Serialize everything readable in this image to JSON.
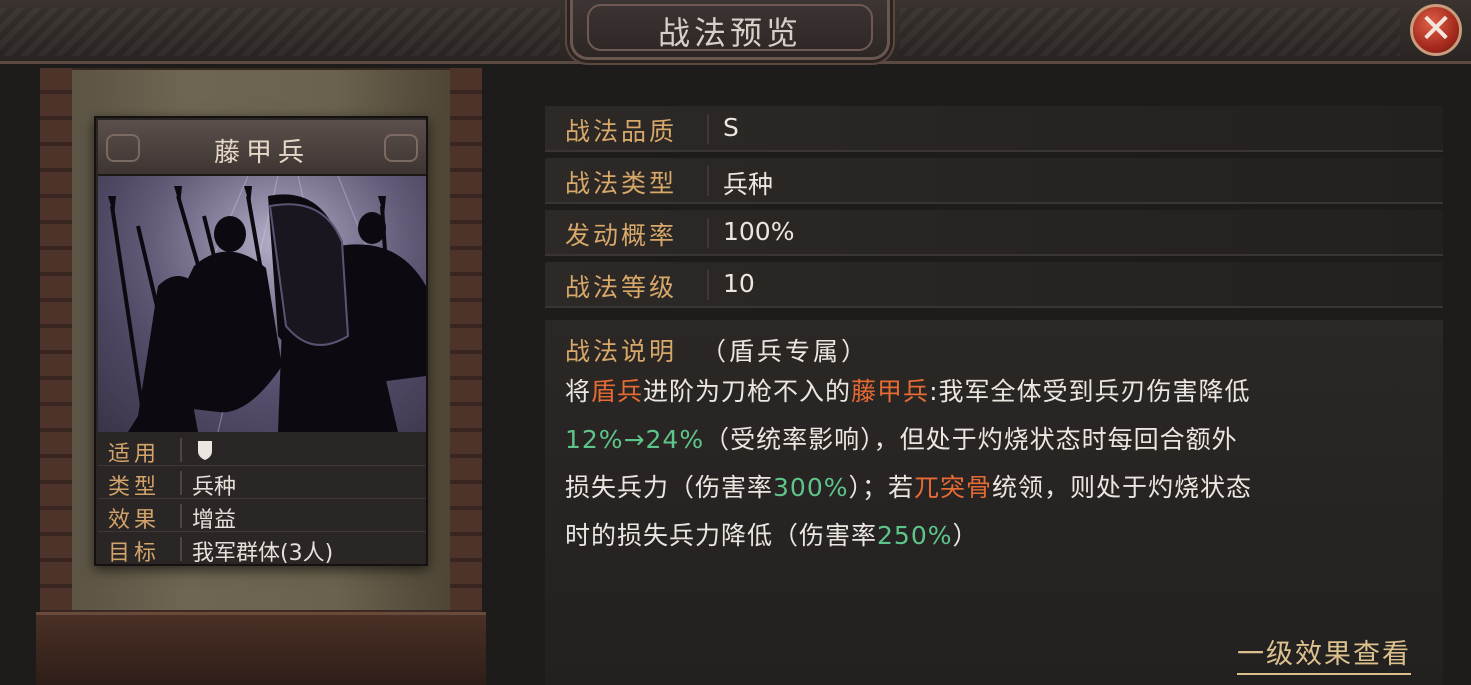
{
  "window": {
    "title": "战法预览",
    "close_label": "✕"
  },
  "card": {
    "name": "藤甲兵",
    "stats": [
      {
        "key": "适用",
        "value": "",
        "icon": "shield-icon"
      },
      {
        "key": "类型",
        "value": "兵种"
      },
      {
        "key": "效果",
        "value": "增益"
      },
      {
        "key": "目标",
        "value": "我军群体(3人)"
      }
    ]
  },
  "info": {
    "rows": [
      {
        "key": "战法品质",
        "value": "S"
      },
      {
        "key": "战法类型",
        "value": "兵种"
      },
      {
        "key": "发动概率",
        "value": "100%"
      },
      {
        "key": "战法等级",
        "value": "10"
      }
    ]
  },
  "description": {
    "key": "战法说明",
    "note": "（盾兵专属）",
    "line1": {
      "a": "将",
      "b": "盾兵",
      "c": "进阶为刀枪不入的",
      "d": "藤甲兵",
      "e": ":我军全体受到兵刃伤害降低"
    },
    "line2": {
      "a": "12%→24%",
      "b": "（受统率影响），但处于灼烧状态时每回合额外"
    },
    "line3": {
      "a": "损失兵力（伤害率",
      "b": "300%",
      "c": "）；若",
      "d": "兀突骨",
      "e": "统领，则处于灼烧状态"
    },
    "line4": {
      "a": "时的损失兵力降低（伤害率",
      "b": "250%",
      "c": "）"
    }
  },
  "footer": {
    "link_label": "一级效果查看"
  },
  "colors": {
    "key_gold": "#d8a86a",
    "highlight_orange": "#e66a34",
    "highlight_green": "#5ec58a",
    "close_red": "#a52a1d"
  }
}
